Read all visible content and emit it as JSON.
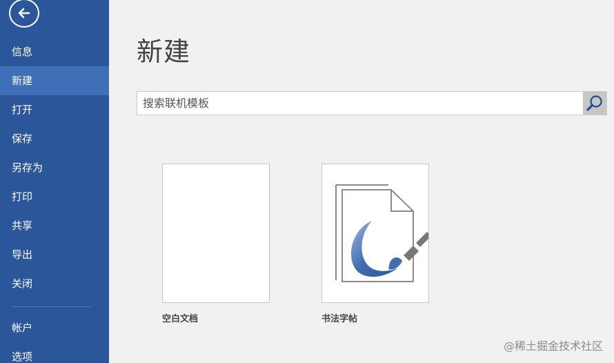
{
  "sidebar": {
    "back_icon": "back-arrow-icon",
    "items": [
      {
        "label": "信息",
        "active": false
      },
      {
        "label": "新建",
        "active": true
      },
      {
        "label": "打开",
        "active": false
      },
      {
        "label": "保存",
        "active": false
      },
      {
        "label": "另存为",
        "active": false
      },
      {
        "label": "打印",
        "active": false
      },
      {
        "label": "共享",
        "active": false
      },
      {
        "label": "导出",
        "active": false
      },
      {
        "label": "关闭",
        "active": false
      }
    ],
    "bottom_items": [
      {
        "label": "帐户"
      },
      {
        "label": "选项"
      }
    ],
    "accent_color": "#2b579a",
    "active_color": "#3f6fb6"
  },
  "main": {
    "title": "新建",
    "search": {
      "placeholder": "搜索联机模板",
      "value": "",
      "button_icon": "search-icon"
    },
    "templates": [
      {
        "label": "空白文档",
        "thumbnail": "blank-page"
      },
      {
        "label": "书法字帖",
        "thumbnail": "calligraphy-brush-icon"
      }
    ]
  },
  "watermark": "@稀土掘金技术社区"
}
